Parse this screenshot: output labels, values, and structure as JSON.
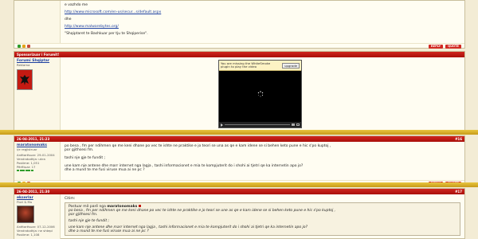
{
  "post0": {
    "line1": "e vazhdo me",
    "link1": "http://www.microsoft.com/en-us/secur...s/default.aspx",
    "line2": "dhe",
    "link2": "http://www.malwarebytes.org/",
    "quote": "\"Shqiptaret te Bashkuar per tju te Shqiperise\"."
  },
  "buttons": {
    "reply": "REPLY",
    "quote": "QUOTE"
  },
  "ad_post": {
    "header": "Sponsorizuar i Forumit!",
    "user": "Forumi Shqiptar",
    "role": "Reklama",
    "player_msg": "You are missing the WhiteSmoke plugin to play the video",
    "upgrade": "upgrade"
  },
  "post1": {
    "date": "26-04-2011, 21:23",
    "num": "#16",
    "user": "maratonomaks",
    "title": "i/e regjistruar",
    "info": [
      "Anëtarësuar: 29-01-2004",
      "Vendndodhja: ukra",
      "Postime: 1,051",
      "Përfituar: 17"
    ],
    "line1": "po besa , fm per ndihmen qe me keni dhane po vec te ishte ne praktike e jo teori se una as qe e kam idene se si behen keto pune e hic s'po kuptoj ,",
    "line2": "por gjithsesi fm.",
    "line3": "tashi nje gje te fundit ;",
    "line4": "une kam nje antene dhe marr internet nga lagja , tashi informacionet e mia te kompjuterit do i shohi ai tjetri qe ka internetin apo jo?",
    "line5": "dhe a mund te me fusi viruse mua ai ne pc ?"
  },
  "post2": {
    "date": "26-04-2011, 21:30",
    "num": "#17",
    "user": "ekserlar",
    "title": "Flori & Mu",
    "info": [
      "Anëtarësuar: 07-12-2006",
      "Vendndodhja: ne shtepi",
      "Postime: 1,108"
    ],
    "quote_label": "Citim:",
    "quote_by": "Postuar më parë nga",
    "quote_user": "maratonomaks",
    "q1": "po besa , fm per ndihmen qe me keni dhane po vec te ishte ne praktike e jo teori se une as qe e kam idene se si behen keto pune e hic s'po kuptoj ,",
    "q2": "por gjithsesi fm.",
    "q3": "tashi nje gje te fundit ;",
    "q4": "une kam nje antene dhe marr internet nga lagja , tashi informacionet e mia te kompjuterit do i shohi ai tjetri qe ka internetin apo jo?",
    "q5": "dhe a mund te me fusi viruse mua ai ne pc ?"
  },
  "colors": {
    "accent": "#c41a12",
    "gold": "#d8b12c",
    "page_bg": "#f3ecd5"
  }
}
